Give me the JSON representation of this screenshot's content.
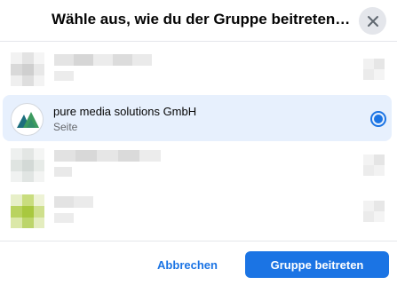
{
  "dialog": {
    "title": "Wähle aus, wie du der Gruppe beitreten…"
  },
  "options": [
    {
      "name": "",
      "subtitle": "",
      "selected": false,
      "blurred": true
    },
    {
      "name": "pure media solutions GmbH",
      "subtitle": "Seite",
      "selected": true,
      "blurred": false
    },
    {
      "name": "",
      "subtitle": "",
      "selected": false,
      "blurred": true
    },
    {
      "name": "",
      "subtitle": "",
      "selected": false,
      "blurred": true
    }
  ],
  "footer": {
    "cancel_label": "Abbrechen",
    "join_label": "Gruppe beitreten"
  },
  "colors": {
    "accent": "#1b74e4",
    "selected_row_bg": "#e7f0fd",
    "logo_teal": "#1c6e7d",
    "logo_green": "#3c9a5f"
  },
  "icons": {
    "close": "close-icon",
    "page_logo": "mountain-logo-icon"
  }
}
